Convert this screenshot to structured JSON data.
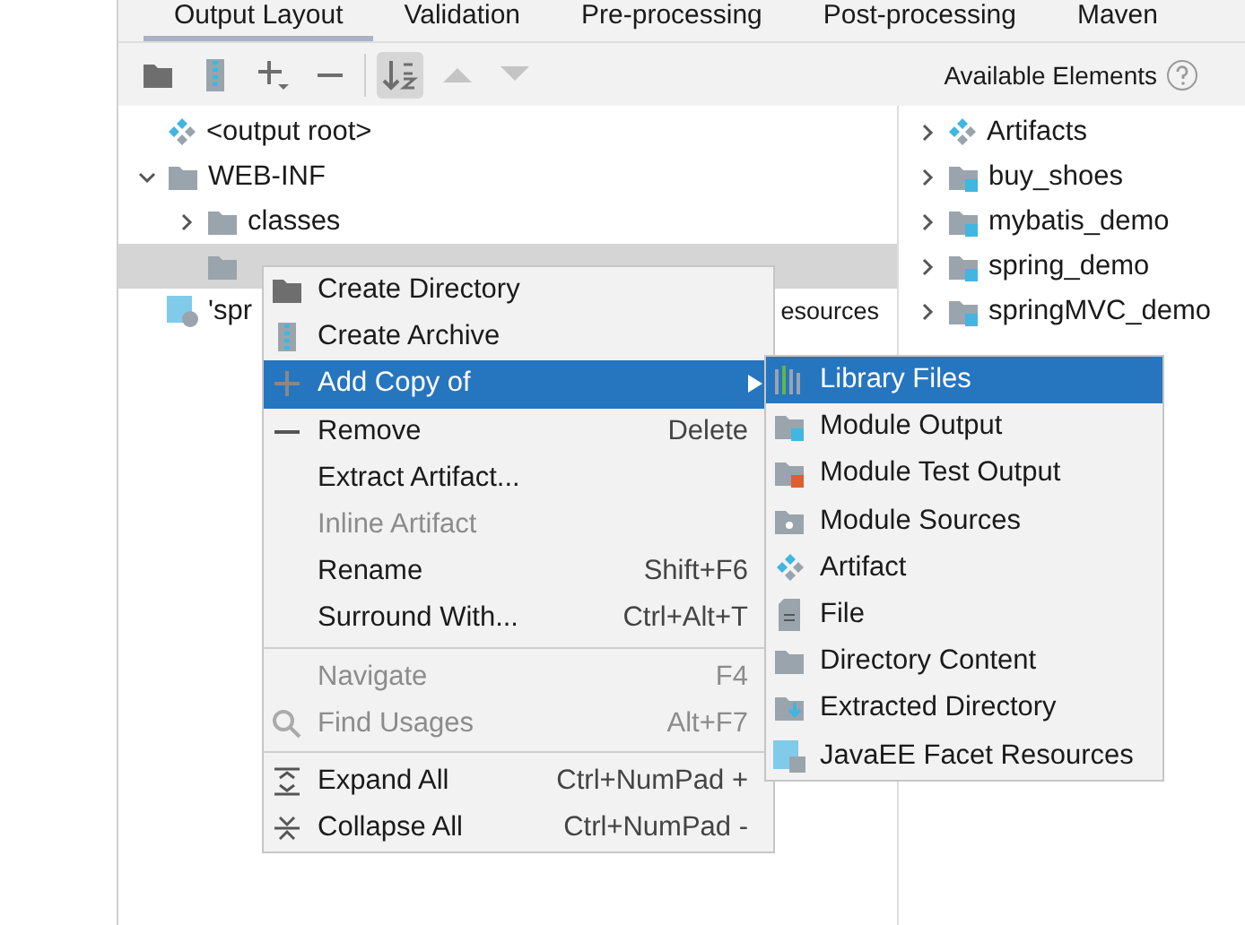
{
  "tabs": [
    {
      "label": "Output Layout",
      "selected": true
    },
    {
      "label": "Validation",
      "selected": false
    },
    {
      "label": "Pre-processing",
      "selected": false
    },
    {
      "label": "Post-processing",
      "selected": false
    },
    {
      "label": "Maven",
      "selected": false
    }
  ],
  "toolbar": [
    {
      "pressed": false,
      "disabled": false
    },
    {
      "pressed": false,
      "disabled": false
    },
    {
      "pressed": false,
      "disabled": false
    },
    {
      "pressed": false,
      "disabled": false
    },
    {
      "pressed": true,
      "disabled": false
    },
    {
      "pressed": false,
      "disabled": true
    },
    {
      "pressed": false,
      "disabled": true
    }
  ],
  "output_tree": [
    {
      "label": "<output root>",
      "kind": "root",
      "selected": false
    },
    {
      "label": "WEB-INF",
      "kind": "folder",
      "expanded": true,
      "selected": false,
      "children": [
        {
          "label": "classes",
          "kind": "folder",
          "expanded": false,
          "selected": false
        },
        {
          "kind": "folder",
          "selected": true
        }
      ]
    },
    {
      "label": "'spr",
      "tail": "esources",
      "kind": "facet",
      "selected": false
    }
  ],
  "available_elements": {
    "title": "Available Elements",
    "items": [
      {
        "label": "Artifacts",
        "kind": "artifacts",
        "expanded": false
      },
      {
        "label": "buy_shoes",
        "kind": "module",
        "expanded": false
      },
      {
        "label": "mybatis_demo",
        "kind": "module",
        "expanded": false
      },
      {
        "label": "spring_demo",
        "kind": "module",
        "expanded": false
      },
      {
        "label": "springMVC_demo",
        "kind": "module",
        "expanded": false
      }
    ]
  },
  "context_menu": [
    {
      "kind": "item",
      "label": "Create Directory",
      "disabled": false,
      "selected": false
    },
    {
      "kind": "item",
      "label": "Create Archive",
      "disabled": false,
      "selected": false
    },
    {
      "kind": "item",
      "label": "Add Copy of",
      "disabled": false,
      "selected": true,
      "submenu": true
    },
    {
      "kind": "item",
      "label": "Remove",
      "shortcut": "Delete",
      "disabled": false,
      "selected": false
    },
    {
      "kind": "item",
      "label": "Extract Artifact...",
      "disabled": false,
      "selected": false
    },
    {
      "kind": "item",
      "label": "Inline Artifact",
      "disabled": true,
      "selected": false
    },
    {
      "kind": "item",
      "label": "Rename",
      "shortcut": "Shift+F6",
      "disabled": false,
      "selected": false
    },
    {
      "kind": "item",
      "label": "Surround With...",
      "shortcut": "Ctrl+Alt+T",
      "disabled": false,
      "selected": false
    },
    {
      "kind": "separator"
    },
    {
      "kind": "item",
      "label": "Navigate",
      "shortcut": "F4",
      "disabled": true,
      "selected": false
    },
    {
      "kind": "item",
      "label": "Find Usages",
      "shortcut": "Alt+F7",
      "disabled": true,
      "selected": false
    },
    {
      "kind": "separator"
    },
    {
      "kind": "item",
      "label": "Expand All",
      "shortcut": "Ctrl+NumPad +",
      "disabled": false,
      "selected": false
    },
    {
      "kind": "item",
      "label": "Collapse All",
      "shortcut": "Ctrl+NumPad -",
      "disabled": false,
      "selected": false
    }
  ],
  "submenu": [
    {
      "label": "Library Files",
      "selected": true
    },
    {
      "label": "Module Output",
      "selected": false
    },
    {
      "label": "Module Test Output",
      "selected": false
    },
    {
      "label": "Module Sources",
      "selected": false
    },
    {
      "label": "Artifact",
      "selected": false
    },
    {
      "label": "File",
      "selected": false
    },
    {
      "label": "Directory Content",
      "selected": false
    },
    {
      "label": "Extracted Directory",
      "selected": false
    },
    {
      "label": "JavaEE Facet Resources",
      "selected": false
    }
  ]
}
